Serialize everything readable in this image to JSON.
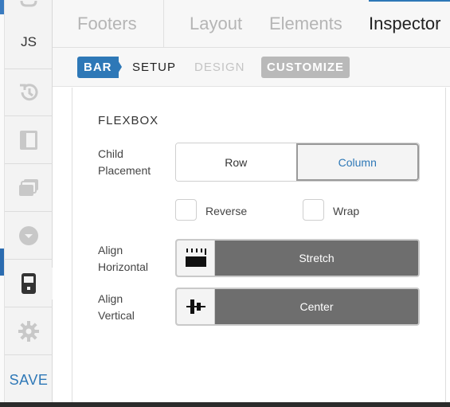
{
  "sidebar": {
    "js_label": "JS",
    "save_label": "SAVE",
    "icons": [
      "css-icon",
      "history-icon",
      "layout-panel-icon",
      "layers-icon",
      "dropdown-circle-icon",
      "mobile-device-icon",
      "settings-gear-icon"
    ]
  },
  "top_tabs": [
    {
      "label": "Footers"
    },
    {
      "label": "Layout"
    },
    {
      "label": "Elements"
    },
    {
      "label": "Inspector"
    }
  ],
  "sub_tabs": {
    "crumb": "BAR",
    "setup": "SETUP",
    "design": "DESIGN",
    "customize": "CUSTOMIZE"
  },
  "panel": {
    "section_title": "FLEXBOX",
    "child_placement": {
      "label_line1": "Child",
      "label_line2": "Placement",
      "options": [
        "Row",
        "Column"
      ],
      "selected": "Column"
    },
    "checkboxes": {
      "reverse": "Reverse",
      "wrap": "Wrap"
    },
    "align_horizontal": {
      "label_line1": "Align",
      "label_line2": "Horizontal",
      "value": "Stretch"
    },
    "align_vertical": {
      "label_line1": "Align",
      "label_line2": "Vertical",
      "value": "Center"
    }
  },
  "colors": {
    "accent": "#2e78b7",
    "select_fill": "#6e6e6e",
    "customize_badge": "#b9b9b9"
  }
}
